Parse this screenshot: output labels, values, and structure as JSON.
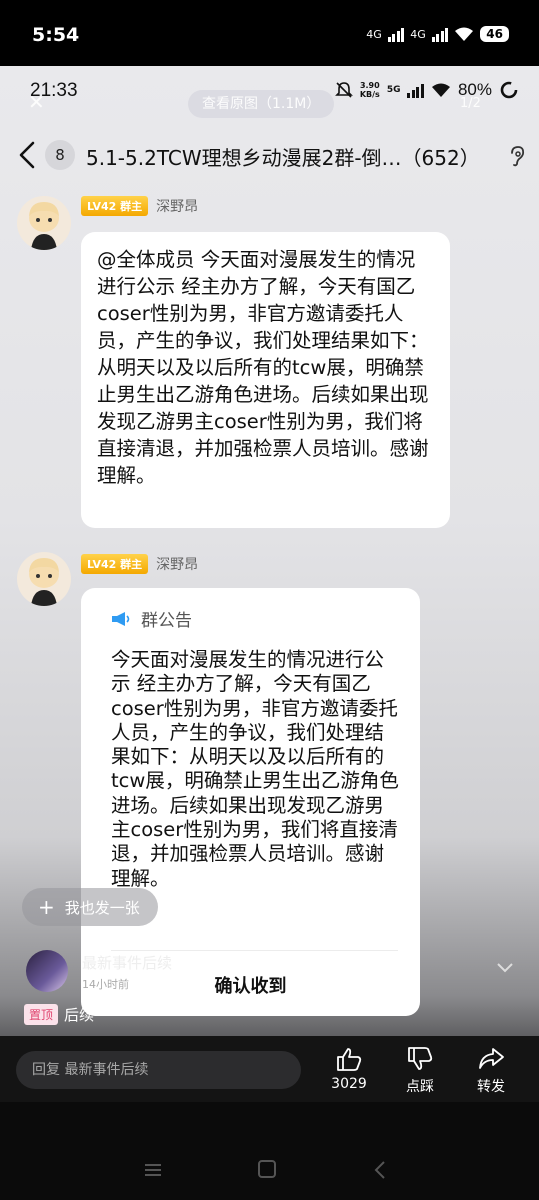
{
  "outer_status": {
    "time": "5:54",
    "net1": "4G",
    "net2": "4G",
    "battery": "46"
  },
  "inner_status": {
    "time": "21:33",
    "speed_value": "3.90",
    "speed_unit": "KB/s",
    "net": "5G",
    "battery": "80%"
  },
  "viewer": {
    "view_original": "查看原图（1.1M）",
    "page": "1/2"
  },
  "header": {
    "unread_count": "8",
    "title": "5.1-5.2TCW理想乡动漫展2群-倒…（652）"
  },
  "messages": [
    {
      "badge": "LV42 群主",
      "sender": "深野昂",
      "text": "@全体成员  今天面对漫展发生的情况进行公示 经主办方了解，今天有国乙coser性别为男，非官方邀请委托人员，产生的争议，我们处理结果如下：从明天以及以后所有的tcw展，明确禁止男生出乙游角色进场。后续如果出现发现乙游男主coser性别为男，我们将直接清退，并加强检票人员培训。感谢理解。"
    },
    {
      "badge": "LV42 群主",
      "sender": "深野昂",
      "notice_title": "群公告",
      "text": "今天面对漫展发生的情况进行公示 经主办方了解，今天有国乙coser性别为男，非官方邀请委托人员，产生的争议，我们处理结果如下：从明天以及以后所有的tcw展，明确禁止男生出乙游角色进场。后续如果出现发现乙游男主coser性别为男，我们将直接清退，并加强检票人员培训。感谢理解。",
      "confirm_label": "确认收到"
    }
  ],
  "post_also_label": "我也发一张",
  "event": {
    "title": "最新事件后续",
    "time": "14小时前"
  },
  "pinned": {
    "tag": "置顶",
    "label": "后续"
  },
  "bottom": {
    "reply_placeholder": "回复 最新事件后续",
    "like_count": "3029",
    "dislike_label": "点踩",
    "share_label": "转发"
  }
}
